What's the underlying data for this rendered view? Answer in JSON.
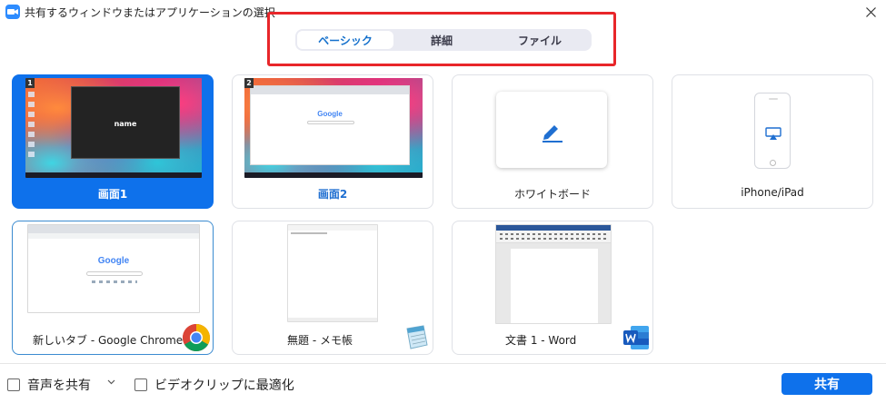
{
  "window": {
    "title": "共有するウィンドウまたはアプリケーションの選択",
    "close_icon": "close-icon"
  },
  "tabs": [
    {
      "label": "ベーシック",
      "selected": true
    },
    {
      "label": "詳細",
      "selected": false
    },
    {
      "label": "ファイル",
      "selected": false
    }
  ],
  "tiles": {
    "screen1": {
      "label": "画面1",
      "badge": "1",
      "inner_text": "name",
      "selected": true
    },
    "screen2": {
      "label": "画面2",
      "badge": "2",
      "google_text": "Google"
    },
    "whiteboard": {
      "label": "ホワイトボード",
      "icon": "pen-icon"
    },
    "iphone": {
      "label": "iPhone/iPad",
      "icon": "airplay-icon"
    },
    "chrome": {
      "label": "新しいタブ - Google Chrome",
      "google_text": "Google",
      "app_icon": "chrome-icon"
    },
    "notepad": {
      "label": "無題 - メモ帳",
      "app_icon": "notepad-icon"
    },
    "word": {
      "label": "文書 1 - Word",
      "app_icon": "word-icon"
    }
  },
  "bottom": {
    "audio_label": "音声を共有",
    "video_label": "ビデオクリップに最適化",
    "share_button": "共有"
  },
  "colors": {
    "accent": "#0e71eb",
    "highlight_box": "#e8262a"
  }
}
